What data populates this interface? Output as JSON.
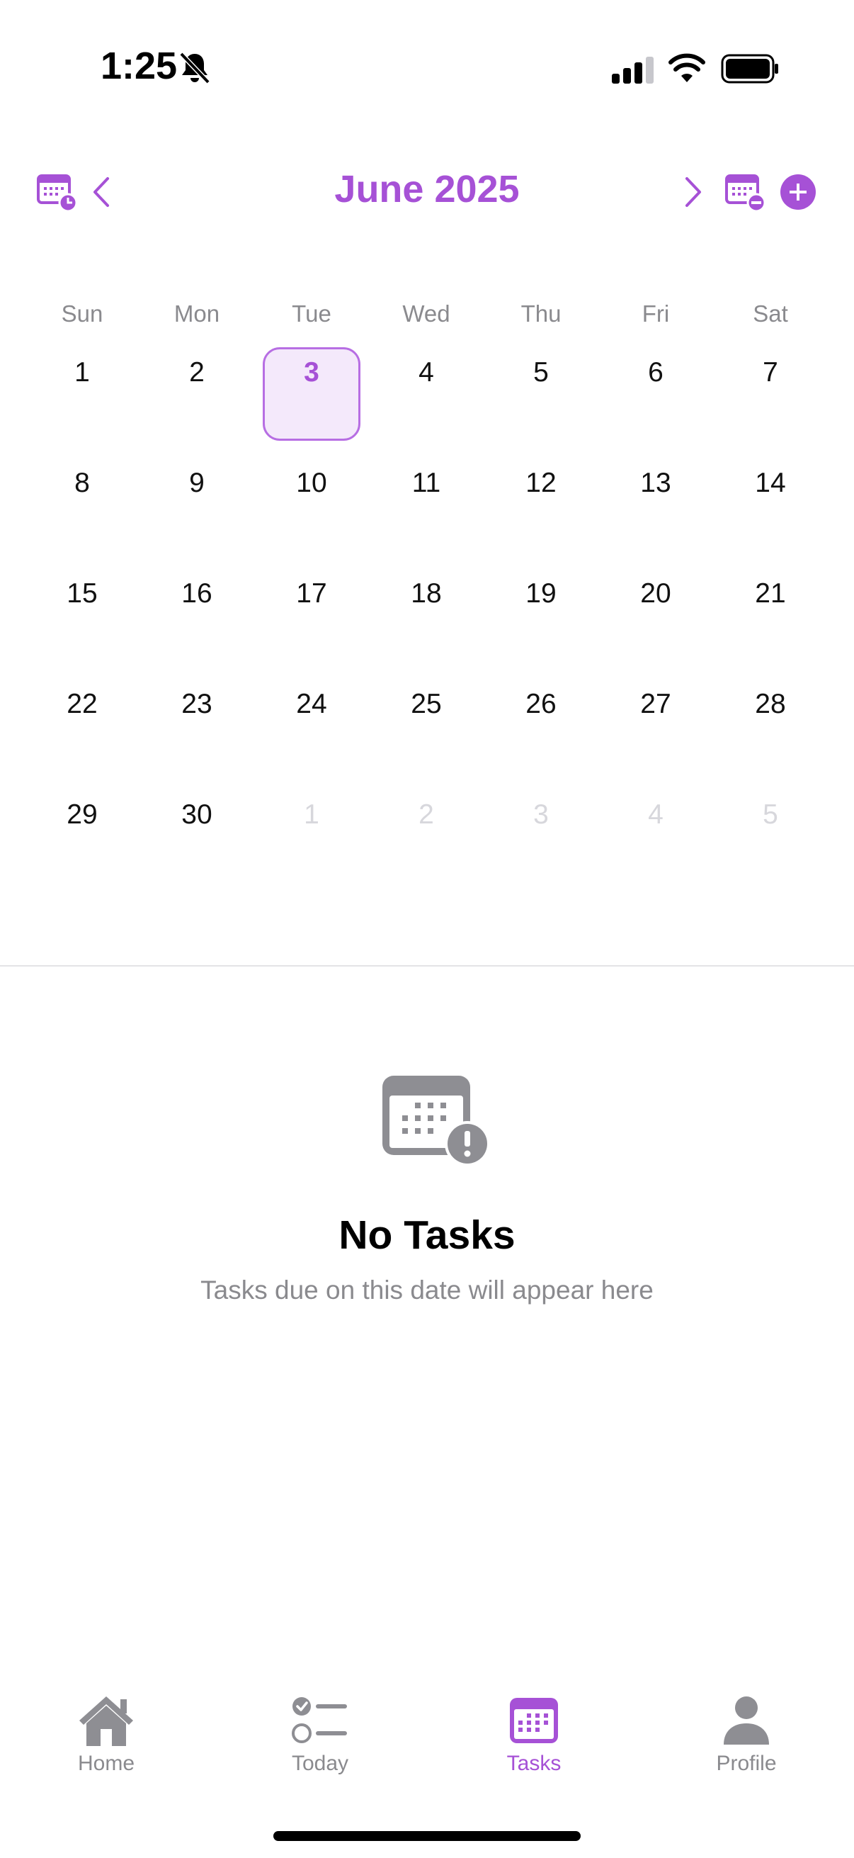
{
  "status": {
    "time": "1:25"
  },
  "header": {
    "month_title": "June 2025"
  },
  "calendar": {
    "weekdays": [
      "Sun",
      "Mon",
      "Tue",
      "Wed",
      "Thu",
      "Fri",
      "Sat"
    ],
    "selected_day": "3",
    "weeks": [
      [
        "1",
        "2",
        "3",
        "4",
        "5",
        "6",
        "7"
      ],
      [
        "8",
        "9",
        "10",
        "11",
        "12",
        "13",
        "14"
      ],
      [
        "15",
        "16",
        "17",
        "18",
        "19",
        "20",
        "21"
      ],
      [
        "22",
        "23",
        "24",
        "25",
        "26",
        "27",
        "28"
      ],
      [
        "29",
        "30",
        "1",
        "2",
        "3",
        "4",
        "5"
      ]
    ]
  },
  "empty_state": {
    "title": "No Tasks",
    "subtitle": "Tasks due on this date will appear here"
  },
  "tabs": [
    {
      "label": "Home",
      "icon": "house-icon"
    },
    {
      "label": "Today",
      "icon": "checklist-icon"
    },
    {
      "label": "Tasks",
      "icon": "calendar-icon"
    },
    {
      "label": "Profile",
      "icon": "person-icon"
    }
  ],
  "colors": {
    "accent": "#a651d6",
    "muted_text": "#8a8a8e",
    "icon_gray": "#8e8e93"
  }
}
